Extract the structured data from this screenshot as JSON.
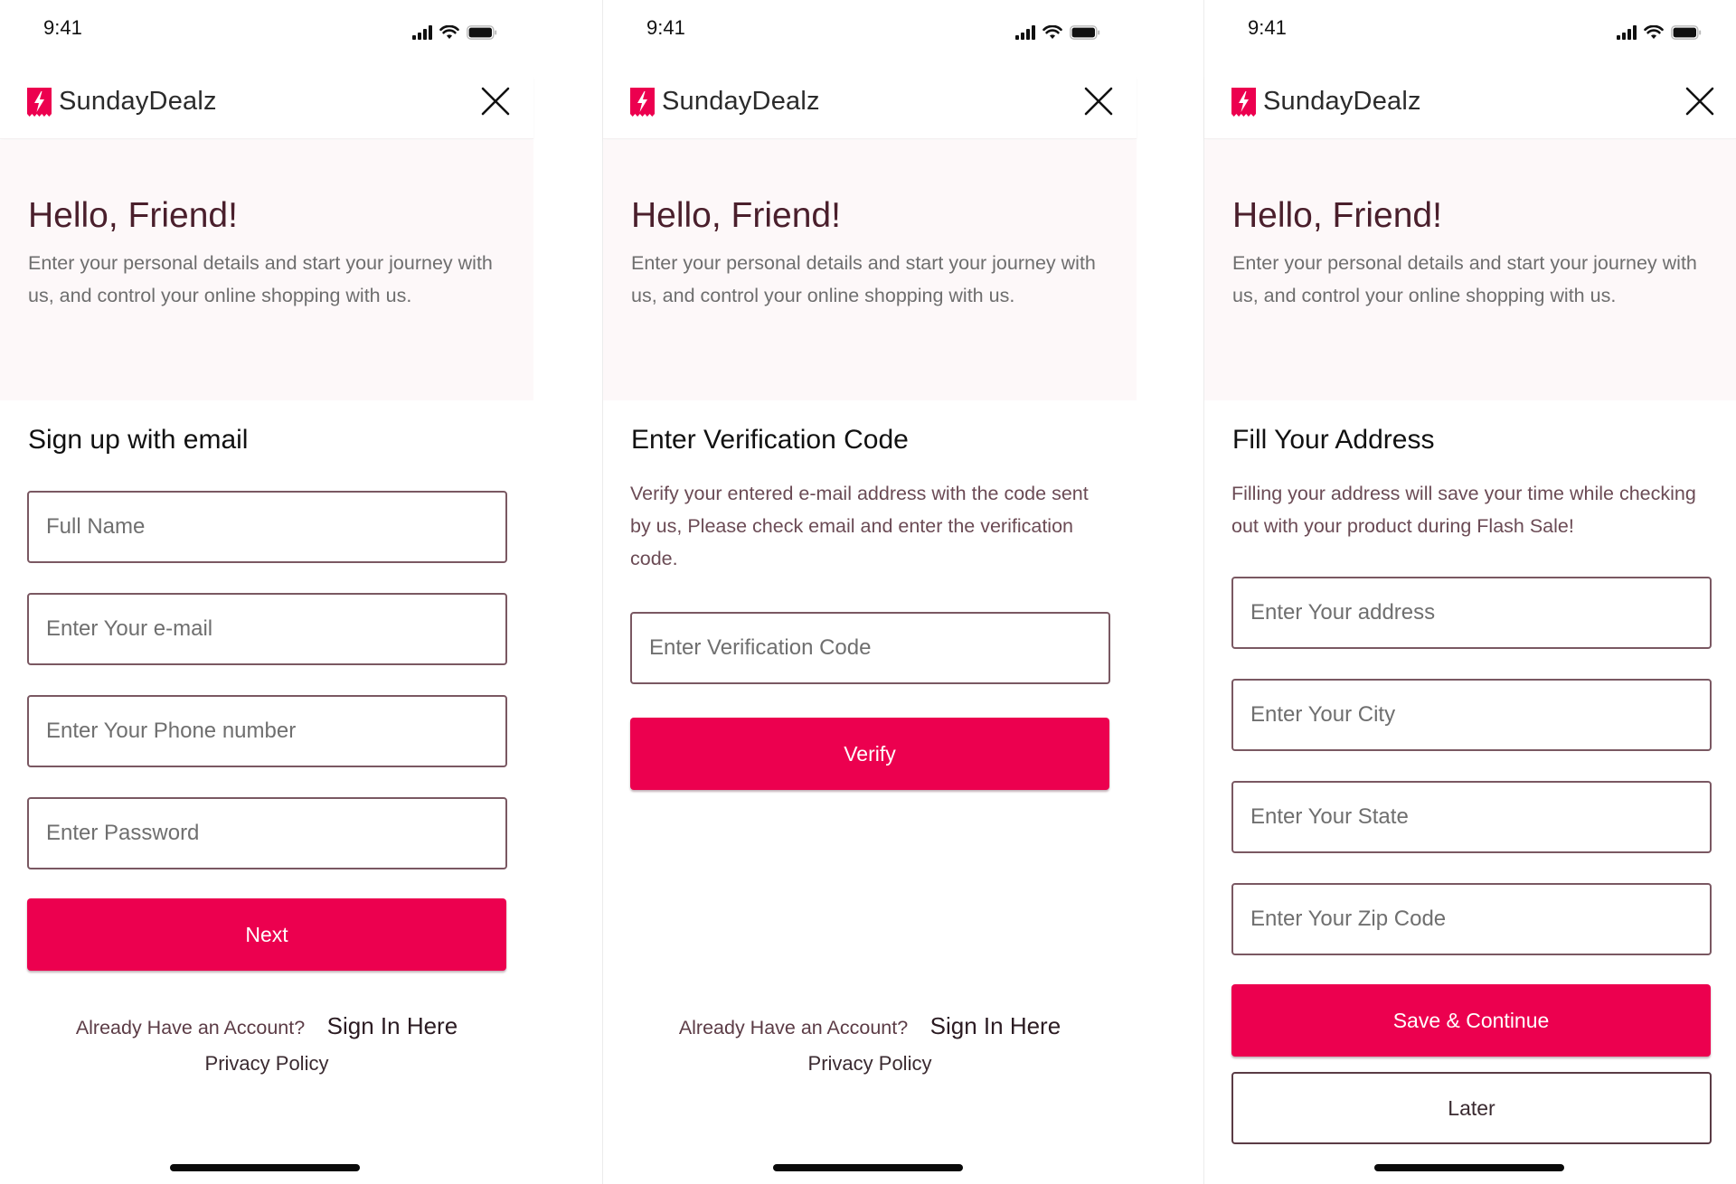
{
  "status_bar": {
    "time": "9:41"
  },
  "brand": {
    "name": "SundayDealz",
    "accent": "#ec004f",
    "heading_color": "#4a1f2c"
  },
  "hero": {
    "title": "Hello, Friend!",
    "subtitle": "Enter your personal details and start your journey with us, and control your online shopping with us."
  },
  "icons": {
    "logo": "lightning-ticket-icon",
    "close": "close-icon",
    "signal": "cellular-signal-icon",
    "wifi": "wifi-icon",
    "battery": "battery-icon"
  },
  "screens": [
    {
      "section_title": "Sign up with email",
      "fields": [
        {
          "placeholder": "Full Name",
          "value": ""
        },
        {
          "placeholder": "Enter Your e-mail",
          "value": ""
        },
        {
          "placeholder": "Enter Your Phone number",
          "value": ""
        },
        {
          "placeholder": "Enter Password",
          "value": ""
        }
      ],
      "primary_button": "Next",
      "signin_prompt": "Already Have an Account?",
      "signin_link": "Sign In Here",
      "privacy_link": "Privacy Policy"
    },
    {
      "section_title": "Enter Verification Code",
      "description": "Verify your entered e-mail address with the code sent by us, Please check email and enter the verification code.",
      "fields": [
        {
          "placeholder": "Enter Verification Code",
          "value": ""
        }
      ],
      "primary_button": "Verify",
      "signin_prompt": "Already Have an Account?",
      "signin_link": "Sign In Here",
      "privacy_link": "Privacy Policy"
    },
    {
      "section_title": "Fill Your Address",
      "description": "Filling your address will save your time while checking out with your product during Flash Sale!",
      "fields": [
        {
          "placeholder": "Enter Your address",
          "value": ""
        },
        {
          "placeholder": "Enter Your City",
          "value": ""
        },
        {
          "placeholder": "Enter Your State",
          "value": ""
        },
        {
          "placeholder": "Enter Your Zip Code",
          "value": ""
        }
      ],
      "primary_button": "Save & Continue",
      "secondary_button": "Later"
    }
  ]
}
